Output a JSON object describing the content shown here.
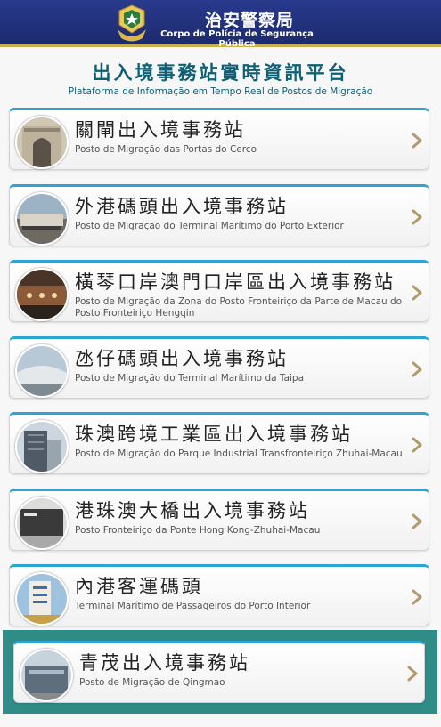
{
  "header": {
    "title": "治安警察局",
    "subtitle": "Corpo de Polícia de Segurança Pública"
  },
  "platform": {
    "title": "出入境事務站實時資訊平台",
    "subtitle": "Plataforma de Informação em Tempo Real de Postos de Migração"
  },
  "colors": {
    "header_blue": "#1f2e78",
    "gold": "#c9b04a",
    "accent_cyan": "#2aa5d6",
    "title_teal": "#0d6077",
    "highlight_teal": "#2f8c87",
    "chevron": "#b39a6a"
  },
  "icons": {
    "logo": "psp-badge-logo",
    "chevron": "chevron-right-icon"
  },
  "stations": [
    {
      "name": "關閘出入境事務站",
      "subtitle": "Posto de Migração das Portas do Cerco"
    },
    {
      "name": "外港碼頭出入境事務站",
      "subtitle": "Posto de Migração do Terminal Marítimo do Porto Exterior"
    },
    {
      "name": "橫琴口岸澳門口岸區出入境事務站",
      "subtitle": "Posto de Migração da Zona do Posto Fronteiriço da Parte de Macau do Posto Fronteiriço Hengqin"
    },
    {
      "name": "氹仔碼頭出入境事務站",
      "subtitle": "Posto de Migração do Terminal Marítimo da Taipa"
    },
    {
      "name": "珠澳跨境工業區出入境事務站",
      "subtitle": "Posto de Migração do Parque Industrial Transfronteiriço Zhuhai-Macau"
    },
    {
      "name": "港珠澳大橋出入境事務站",
      "subtitle": "Posto Fronteiriço da Ponte Hong Kong-Zhuhai-Macau"
    },
    {
      "name": "內港客運碼頭",
      "subtitle": "Terminal Marítimo de Passageiros do Porto Interior"
    },
    {
      "name": "青茂出入境事務站",
      "subtitle": "Posto de Migração de Qingmao",
      "selected": true
    }
  ]
}
